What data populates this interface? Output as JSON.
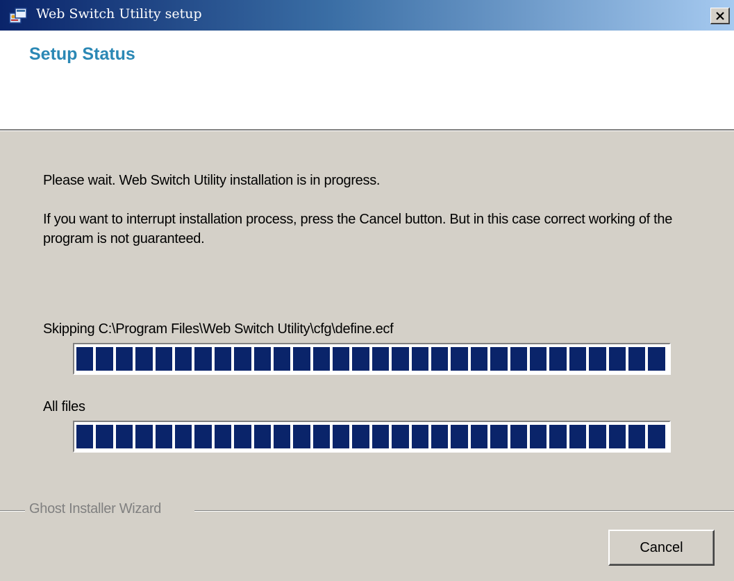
{
  "window": {
    "title": "Web Switch Utility setup",
    "title_icon": "installer-icon",
    "close_icon": "close-icon",
    "colors": {
      "titlebar_start": "#0a246a",
      "titlebar_end": "#a6caf0",
      "header_title": "#2b88b5",
      "progress_fill": "#0a246a",
      "face": "#d4d0c8"
    }
  },
  "header": {
    "title": "Setup Status"
  },
  "body": {
    "message_wait": "Please wait. Web Switch Utility installation is in progress.",
    "message_cancel": "If you want to interrupt installation process, press the Cancel button. But in this case correct working of the program is not guaranteed."
  },
  "progress": {
    "current_file_label": "Skipping C:\\Program Files\\Web Switch Utility\\cfg\\define.ecf",
    "current_file_fraction": 1.0,
    "all_files_label": "All files",
    "all_files_fraction": 1.0
  },
  "footer": {
    "group_label": "Ghost Installer Wizard",
    "cancel_label": "Cancel"
  }
}
